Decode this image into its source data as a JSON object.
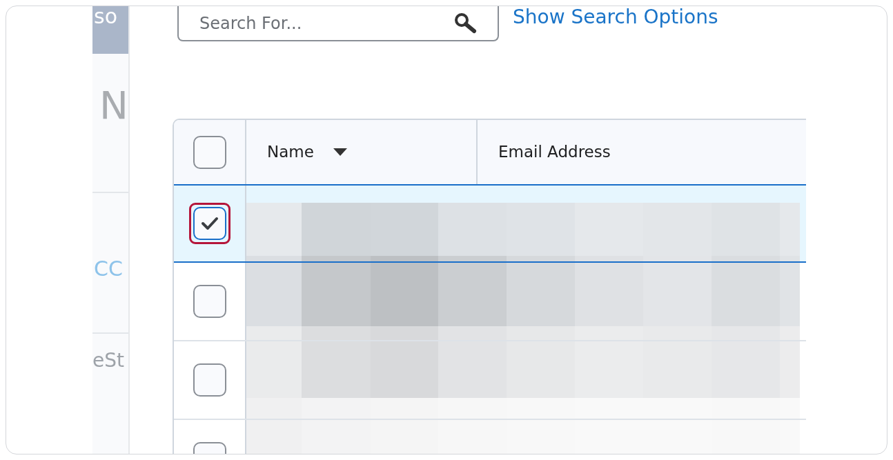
{
  "sidebar": {
    "items": [
      {
        "kind": "band",
        "text": "so"
      },
      {
        "kind": "heading",
        "text": "N"
      },
      {
        "kind": "link",
        "text": "CC"
      },
      {
        "kind": "text",
        "text": "eSt"
      }
    ]
  },
  "search": {
    "placeholder": "Search For...",
    "options_link": "Show Search Options"
  },
  "table": {
    "header_checkbox": {
      "checked": false
    },
    "columns": [
      {
        "label": "Name",
        "sorted": true
      },
      {
        "label": "Email Address",
        "sorted": false
      }
    ],
    "rows": [
      {
        "checked": true,
        "annotated": true
      },
      {
        "checked": false,
        "annotated": false
      },
      {
        "checked": false,
        "annotated": false
      },
      {
        "checked": false,
        "annotated": false
      }
    ]
  }
}
